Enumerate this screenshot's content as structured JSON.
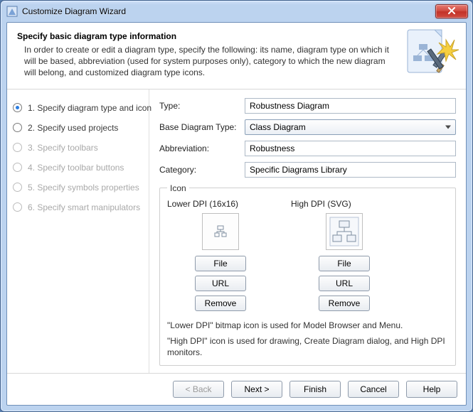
{
  "window": {
    "title": "Customize Diagram Wizard"
  },
  "banner": {
    "title": "Specify basic diagram type information",
    "desc": "In order to create or edit a diagram type, specify the following: its name, diagram type on which it will be based, abbreviation (used for system purposes only), category to which the new diagram will belong, and customized diagram type icons."
  },
  "steps": [
    {
      "label": "1. Specify diagram type and icon",
      "selected": true,
      "enabled": true
    },
    {
      "label": "2. Specify used projects",
      "selected": false,
      "enabled": true
    },
    {
      "label": "3. Specify toolbars",
      "selected": false,
      "enabled": false
    },
    {
      "label": "4. Specify toolbar buttons",
      "selected": false,
      "enabled": false
    },
    {
      "label": "5. Specify symbols properties",
      "selected": false,
      "enabled": false
    },
    {
      "label": "6. Specify smart manipulators",
      "selected": false,
      "enabled": false
    }
  ],
  "form": {
    "type_label": "Type:",
    "type_value": "Robustness Diagram",
    "base_label": "Base Diagram Type:",
    "base_value": "Class Diagram",
    "abbrev_label": "Abbreviation:",
    "abbrev_value": "Robustness",
    "category_label": "Category:",
    "category_value": "Specific Diagrams Library"
  },
  "icon": {
    "legend": "Icon",
    "low_title": "Lower DPI (16x16)",
    "high_title": "High DPI (SVG)",
    "file_btn": "File",
    "url_btn": "URL",
    "remove_btn": "Remove",
    "note1": "\"Lower DPI\" bitmap icon is used for Model Browser and Menu.",
    "note2": "\"High DPI\" icon is used for drawing, Create Diagram dialog, and High DPI monitors."
  },
  "footer": {
    "back": "< Back",
    "next": "Next >",
    "finish": "Finish",
    "cancel": "Cancel",
    "help": "Help"
  }
}
